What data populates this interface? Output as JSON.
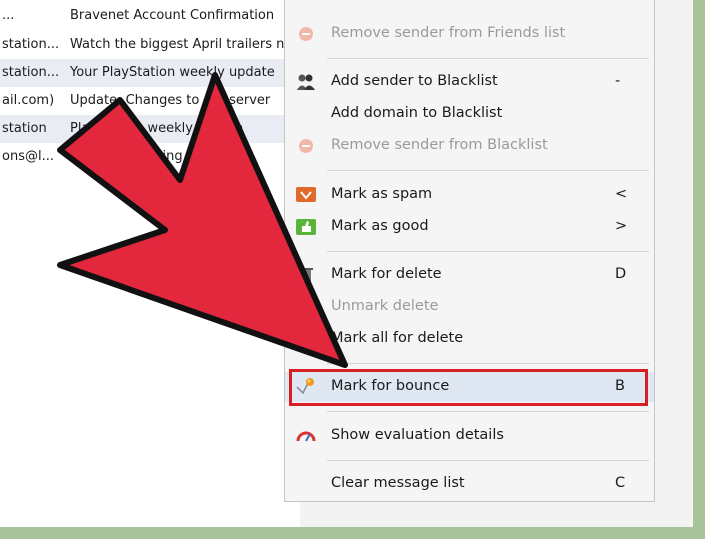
{
  "message_list": {
    "rows": [
      {
        "sender": "...",
        "subject": "Bravenet Account Confirmation"
      },
      {
        "sender": "station...",
        "subject": "Watch the biggest April trailers n"
      },
      {
        "sender": "station...",
        "subject": "Your PlayStation weekly update"
      },
      {
        "sender": "ail.com)",
        "subject": "Update: Changes to our server"
      },
      {
        "sender": "station",
        "subject": "PlayStation weekly update"
      },
      {
        "sender": "ons@l...",
        "subject": "invitation waiting"
      }
    ]
  },
  "context_menu": {
    "items": [
      {
        "label": "Remove sender from Friends list",
        "key": "",
        "icon": "remove-icon",
        "disabled": true
      },
      {
        "label": "Add sender to Blacklist",
        "key": "-",
        "icon": "blacklist-people-icon",
        "disabled": false
      },
      {
        "label": "Add domain to Blacklist",
        "key": "",
        "icon": "",
        "disabled": false
      },
      {
        "label": "Remove sender from Blacklist",
        "key": "",
        "icon": "remove-icon",
        "disabled": true
      },
      {
        "label": "Mark as spam",
        "key": "<",
        "icon": "spam-icon",
        "disabled": false
      },
      {
        "label": "Mark as good",
        "key": ">",
        "icon": "thumbs-up-icon",
        "disabled": false
      },
      {
        "label": "Mark for delete",
        "key": "D",
        "icon": "trash-icon",
        "disabled": false
      },
      {
        "label": "Unmark delete",
        "key": "",
        "icon": "",
        "disabled": true
      },
      {
        "label": "Mark all for delete",
        "key": "",
        "icon": "",
        "disabled": false
      },
      {
        "label": "Mark for bounce",
        "key": "B",
        "icon": "bounce-icon",
        "disabled": false,
        "highlighted": true
      },
      {
        "label": "Show evaluation details",
        "key": "",
        "icon": "gauge-icon",
        "disabled": false
      },
      {
        "label": "Clear message list",
        "key": "C",
        "icon": "",
        "disabled": false
      }
    ]
  },
  "colors": {
    "frame": "#a9c49b",
    "highlight_border": "#d61e24",
    "arrow_fill": "#e3283e",
    "arrow_stroke": "#111111"
  }
}
